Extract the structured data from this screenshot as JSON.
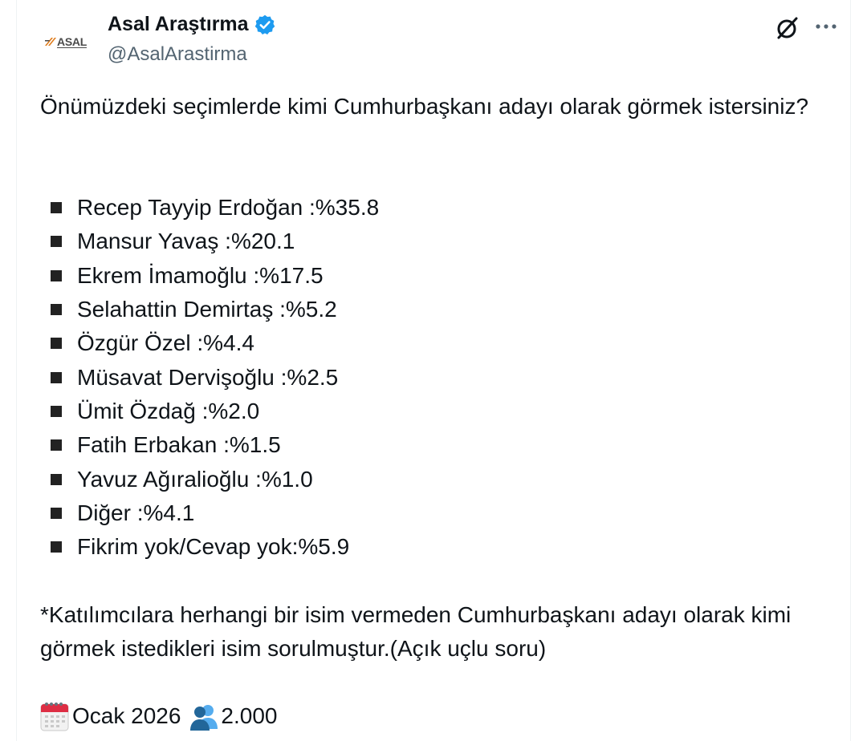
{
  "author": {
    "display_name": "Asal Araştırma",
    "handle": "@AsalArastirma",
    "verified": true,
    "avatar_logo_text": "ASAL"
  },
  "icons": {
    "verified": "verified-badge-icon",
    "grok": "grok-icon",
    "more": "more-icon",
    "calendar": "calendar-icon",
    "people": "people-icon"
  },
  "tweet": {
    "question": "Önümüzdeki seçimlerde kimi Cumhurbaşkanı adayı olarak görmek istersiniz?",
    "results": [
      {
        "label": "Recep Tayyip Erdoğan :%35.8"
      },
      {
        "label": "Mansur Yavaş :%20.1"
      },
      {
        "label": "Ekrem İmamoğlu :%17.5"
      },
      {
        "label": "Selahattin Demirtaş :%5.2"
      },
      {
        "label": "Özgür Özel :%4.4"
      },
      {
        "label": "Müsavat Dervişoğlu :%2.5"
      },
      {
        "label": "Ümit Özdağ :%2.0"
      },
      {
        "label": "Fatih Erbakan :%1.5"
      },
      {
        "label": "Yavuz Ağıralioğlu :%1.0"
      },
      {
        "label": "Diğer :%4.1"
      },
      {
        "label": "Fikrim yok/Cevap yok:%5.9"
      }
    ],
    "note": "*Katılımcılara herhangi bir isim vermeden Cumhurbaşkanı adayı olarak kimi görmek istedikleri isim sorulmuştur.(Açık uçlu soru)",
    "date": "Ocak 2026",
    "sample_size": "2.000"
  },
  "colors": {
    "verified_blue": "#1d9bf0",
    "text_primary": "#0f1419",
    "text_secondary": "#536471"
  }
}
